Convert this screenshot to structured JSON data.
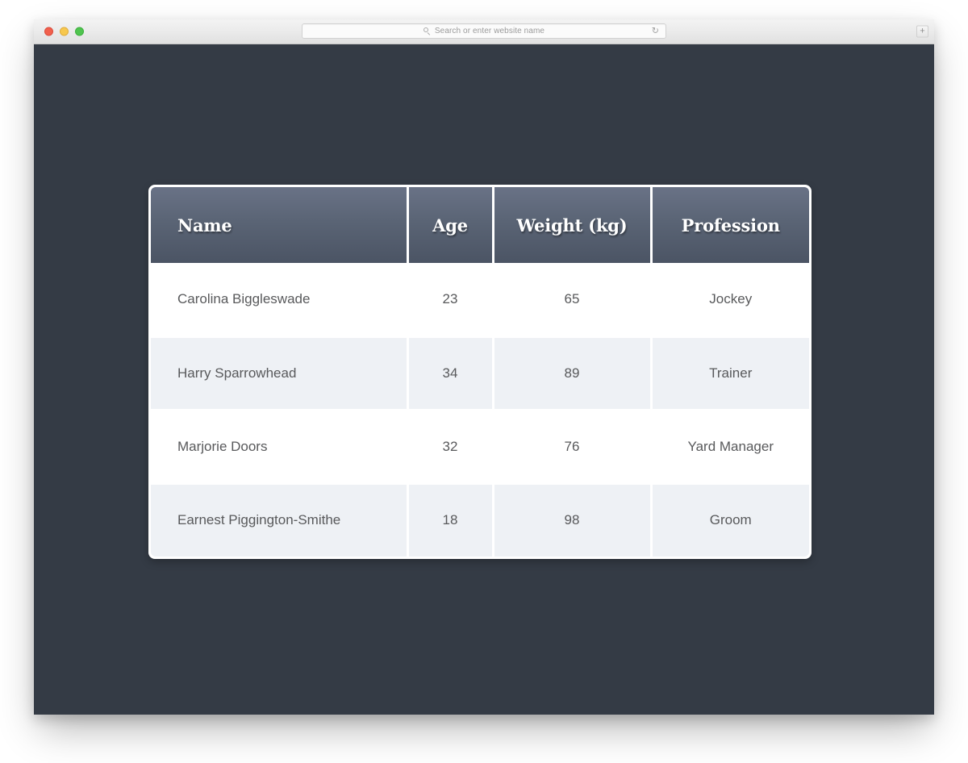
{
  "browser": {
    "traffic_lights": [
      {
        "name": "close",
        "color": "#f1604d"
      },
      {
        "name": "minimize",
        "color": "#f7c84f"
      },
      {
        "name": "maximize",
        "color": "#4fc44f"
      }
    ],
    "address_bar": {
      "value": "",
      "placeholder": "Search or enter website name",
      "search_icon": "search-icon",
      "reload_icon": "↻"
    },
    "new_tab_label": "+"
  },
  "page": {
    "background_color": "#343b45"
  },
  "table": {
    "accent_header_top": "#697286",
    "accent_header_bottom": "#4b5464",
    "stripe_color": "#eef1f5",
    "columns": [
      {
        "key": "name",
        "label": "Name",
        "align": "left"
      },
      {
        "key": "age",
        "label": "Age",
        "align": "center"
      },
      {
        "key": "weight",
        "label": "Weight (kg)",
        "align": "center"
      },
      {
        "key": "profession",
        "label": "Profession",
        "align": "center"
      }
    ],
    "rows": [
      {
        "name": "Carolina Biggleswade",
        "age": "23",
        "weight": "65",
        "profession": "Jockey"
      },
      {
        "name": "Harry Sparrowhead",
        "age": "34",
        "weight": "89",
        "profession": "Trainer"
      },
      {
        "name": "Marjorie Doors",
        "age": "32",
        "weight": "76",
        "profession": "Yard Manager"
      },
      {
        "name": "Earnest Piggington-Smithe",
        "age": "18",
        "weight": "98",
        "profession": "Groom"
      }
    ]
  }
}
